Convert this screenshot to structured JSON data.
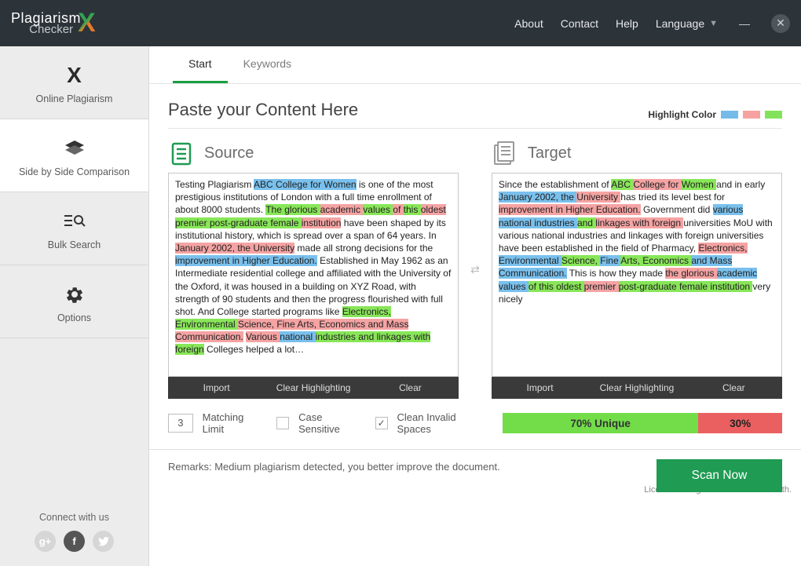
{
  "logo": {
    "l1": "Plagiarism",
    "l2": "Checker"
  },
  "topmenu": {
    "about": "About",
    "contact": "Contact",
    "help": "Help",
    "language": "Language"
  },
  "sidebar": {
    "items": [
      {
        "label": "Online Plagiarism"
      },
      {
        "label": "Side by Side Comparison"
      },
      {
        "label": "Bulk Search"
      },
      {
        "label": "Options"
      }
    ],
    "connect": "Connect with us"
  },
  "tabs": {
    "start": "Start",
    "keywords": "Keywords"
  },
  "section": {
    "title": "Paste your Content Here",
    "hlcolor": "Highlight Color"
  },
  "panels": {
    "source": "Source",
    "target": "Target"
  },
  "actionbar": {
    "import": "Import",
    "clearhl": "Clear Highlighting",
    "clear": "Clear"
  },
  "opts": {
    "matching_limit_value": "3",
    "matching_limit": "Matching Limit",
    "case_sensitive": "Case Sensitive",
    "clean_invalid": "Clean Invalid Spaces"
  },
  "result": {
    "unique": "70% Unique",
    "dup": "30%"
  },
  "footer": {
    "remarks": "Remarks: Medium plagiarism detected, you better improve the document.",
    "scan": "Scan Now",
    "license": "License is Registered to Andew Smith."
  },
  "source_text": {
    "t0": "Testing Plagiarism ",
    "h1": "ABC College for Women",
    "t1": " is one of the most prestigious institutions of London with a full time enrollment of about 8000 students. ",
    "h2": "The glorious ",
    "h3": "academic ",
    "h4": "values ",
    "h5": "of ",
    "h6": "this ",
    "h7": "oldest ",
    "h8": "premier post-graduate female ",
    "h9": "institution",
    "t2": " have been shaped by its institutional history, which is spread over a span of 64 years. In ",
    "h10": "January 2002, the University",
    "t3": " made all strong decisions for the ",
    "h11": "improvement in Higher Education.",
    "t4": " Established in May 1962 as an Intermediate residential college and affiliated with the University of the Oxford, it was housed in a building on XYZ Road, with strength of 90 students and then the progress flourished with full shot. And College started programs like ",
    "h12": "Electronics, Environmental ",
    "h13": "Science, Fine Arts, Economics and Mass Communication.",
    "t5": " ",
    "h14": "Various ",
    "h15": "national ",
    "h16": "industries and linkages with foreign",
    "t6": " Colleges helped a lot…"
  },
  "target_text": {
    "t0": "Since the establishment of ",
    "h1": "ABC ",
    "h2": "College for ",
    "h3": "Women ",
    "t1": "and in early ",
    "h4": "January 2002, the ",
    "h5": "University ",
    "t2": "has tried its level best for ",
    "h6": "improvement in Higher Education.",
    "t3": " Government did ",
    "h7": "various national industries ",
    "h8": "and ",
    "h9": "linkages with foreign ",
    "t4": "universities MoU with various national industries and linkages with foreign universities have been established in the field of Pharmacy, ",
    "h10": "Electronics, ",
    "h11": "Environmental ",
    "h12": "Science, ",
    "h13": "Fine ",
    "h14": "Arts, Economics ",
    "h15": "and Mass Communication.",
    "t5": " This is how they made ",
    "h16": "the glorious ",
    "h17": "academic values ",
    "h18": "of this oldest ",
    "h19": "premier ",
    "h20": "post-graduate female institution ",
    "t6": "very nicely"
  }
}
